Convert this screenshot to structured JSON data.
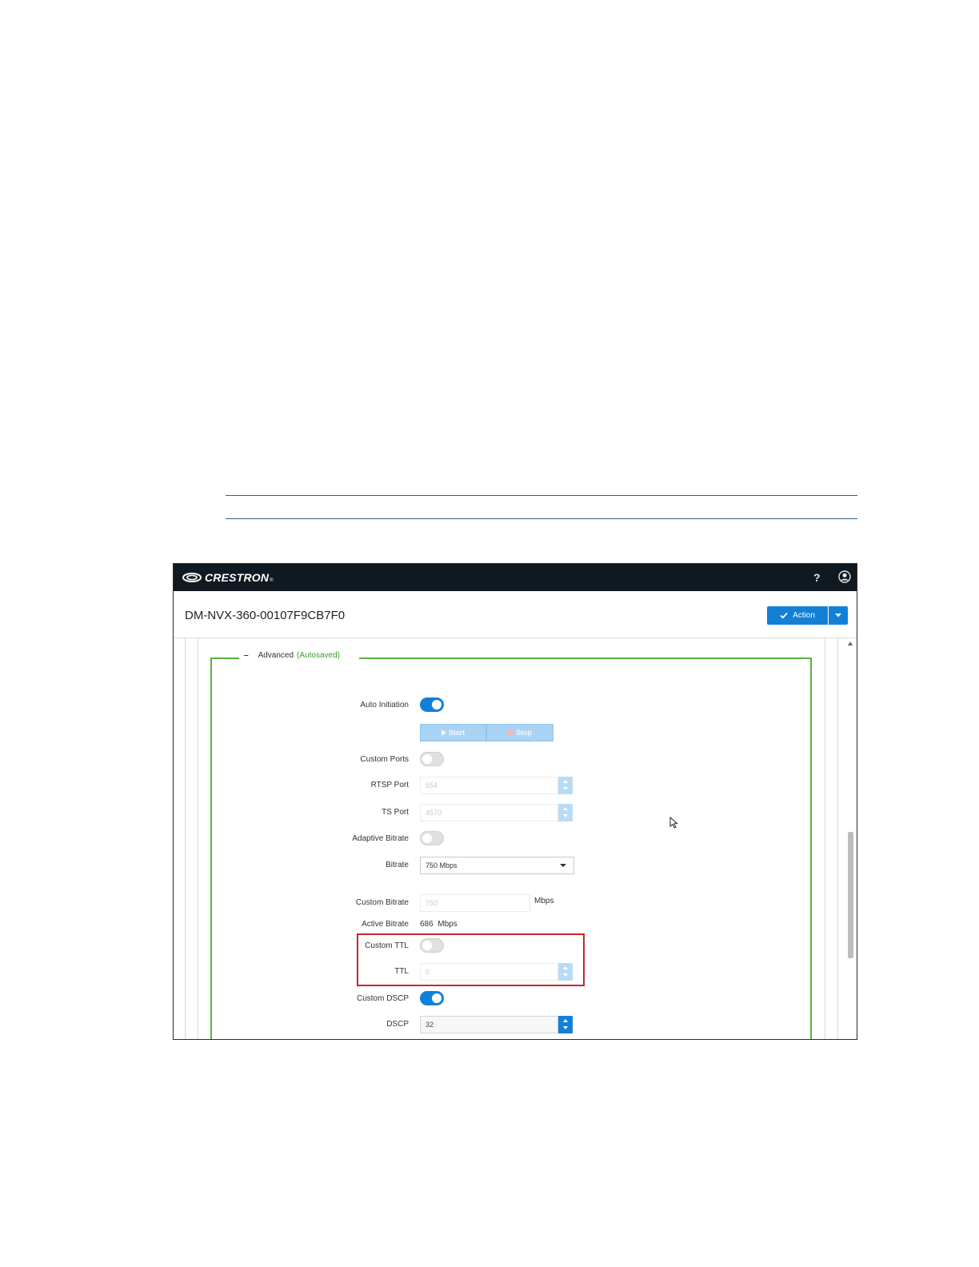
{
  "app": {
    "brand": "CRESTRON",
    "help_label": "?",
    "device_name": "DM-NVX-360-00107F9CB7F0",
    "action_label": "Action"
  },
  "section": {
    "collapse_symbol": "–",
    "title": "Advanced",
    "status": "(Autosaved)"
  },
  "fields": {
    "auto_initiation": {
      "label": "Auto Initiation",
      "value": true
    },
    "stream_buttons": {
      "start": "Start",
      "stop": "Stop"
    },
    "custom_ports": {
      "label": "Custom Ports",
      "value": false
    },
    "rtsp_port": {
      "label": "RTSP Port",
      "value": "554"
    },
    "ts_port": {
      "label": "TS Port",
      "value": "4570"
    },
    "adaptive_bitrate": {
      "label": "Adaptive Bitrate",
      "value": false
    },
    "bitrate": {
      "label": "Bitrate",
      "value": "750 Mbps"
    },
    "custom_bitrate": {
      "label": "Custom Bitrate",
      "value": "750",
      "unit": "Mbps"
    },
    "active_bitrate": {
      "label": "Active Bitrate",
      "value": "686  Mbps"
    },
    "custom_ttl": {
      "label": "Custom TTL",
      "value": false
    },
    "ttl": {
      "label": "TTL",
      "value": "0"
    },
    "custom_dscp": {
      "label": "Custom DSCP",
      "value": true
    },
    "dscp": {
      "label": "DSCP",
      "value": "32"
    }
  },
  "colors": {
    "topbar": "#101820",
    "accent_blue": "#1380d8",
    "section_border": "#56b23e",
    "autosaved_text": "#3c9a2a",
    "highlight_box": "#c4282e"
  },
  "icons": [
    "crestron-logo-icon",
    "help-icon",
    "user-account-icon",
    "checkmark-icon",
    "chevron-down-icon",
    "play-icon",
    "stop-icon",
    "scroll-up-icon",
    "mouse-pointer-icon"
  ]
}
